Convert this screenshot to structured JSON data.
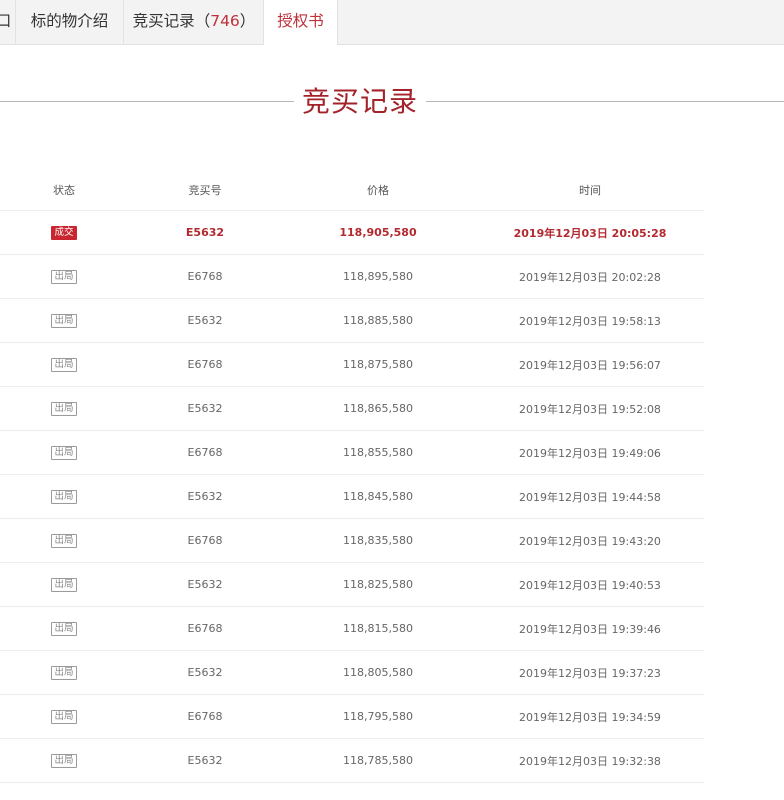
{
  "tabs": {
    "partial_label": "口",
    "intro_label": "标的物介绍",
    "records_label": "竞买记录",
    "records_paren_open": "（",
    "records_count": "746",
    "records_paren_close": "）",
    "auth_label": "授权书"
  },
  "section": {
    "title": "竞买记录"
  },
  "table": {
    "headers": {
      "status": "状态",
      "bid_no": "竞买号",
      "price": "价格",
      "time": "时间"
    },
    "rows": [
      {
        "status": "成交",
        "bid_no": "E5632",
        "price": "118,905,580",
        "time": "2019年12月03日 20:05:28"
      },
      {
        "status": "出局",
        "bid_no": "E6768",
        "price": "118,895,580",
        "time": "2019年12月03日 20:02:28"
      },
      {
        "status": "出局",
        "bid_no": "E5632",
        "price": "118,885,580",
        "time": "2019年12月03日 19:58:13"
      },
      {
        "status": "出局",
        "bid_no": "E6768",
        "price": "118,875,580",
        "time": "2019年12月03日 19:56:07"
      },
      {
        "status": "出局",
        "bid_no": "E5632",
        "price": "118,865,580",
        "time": "2019年12月03日 19:52:08"
      },
      {
        "status": "出局",
        "bid_no": "E6768",
        "price": "118,855,580",
        "time": "2019年12月03日 19:49:06"
      },
      {
        "status": "出局",
        "bid_no": "E5632",
        "price": "118,845,580",
        "time": "2019年12月03日 19:44:58"
      },
      {
        "status": "出局",
        "bid_no": "E6768",
        "price": "118,835,580",
        "time": "2019年12月03日 19:43:20"
      },
      {
        "status": "出局",
        "bid_no": "E5632",
        "price": "118,825,580",
        "time": "2019年12月03日 19:40:53"
      },
      {
        "status": "出局",
        "bid_no": "E6768",
        "price": "118,815,580",
        "time": "2019年12月03日 19:39:46"
      },
      {
        "status": "出局",
        "bid_no": "E5632",
        "price": "118,805,580",
        "time": "2019年12月03日 19:37:23"
      },
      {
        "status": "出局",
        "bid_no": "E6768",
        "price": "118,795,580",
        "time": "2019年12月03日 19:34:59"
      },
      {
        "status": "出局",
        "bid_no": "E5632",
        "price": "118,785,580",
        "time": "2019年12月03日 19:32:38"
      }
    ]
  },
  "colors": {
    "accent": "#c0303a",
    "title": "#a3232b",
    "won_badge": "#c9262f"
  }
}
